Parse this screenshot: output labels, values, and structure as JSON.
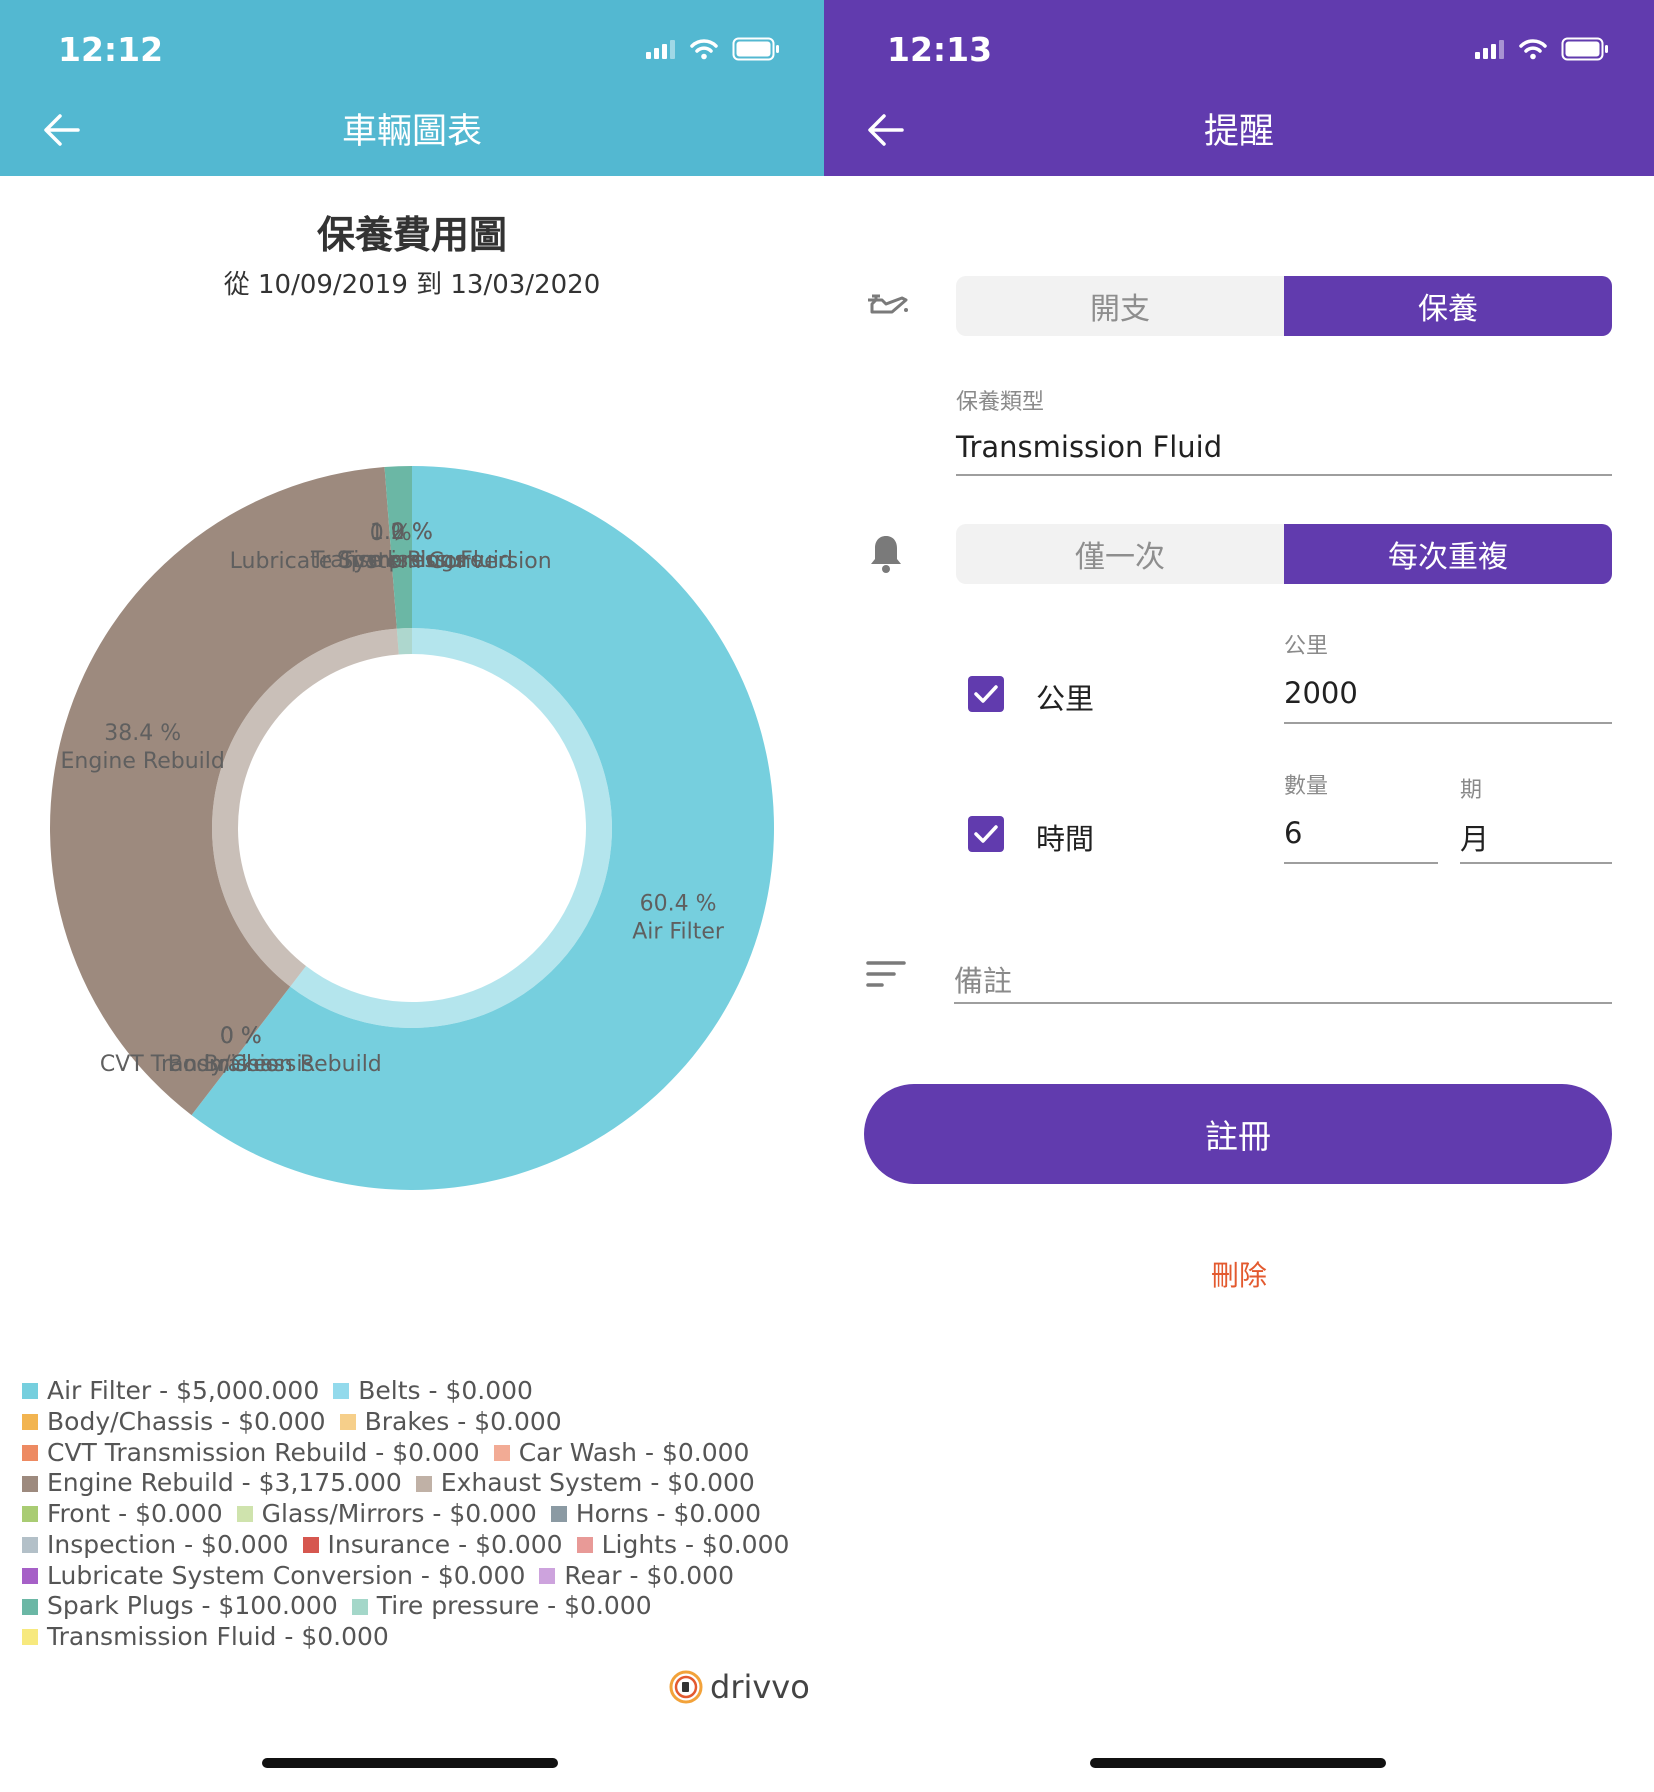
{
  "left": {
    "status_time": "12:12",
    "header_title": "車輛圖表",
    "chart_title": "保養費用圖",
    "chart_subtitle": "從 10/09/2019 到 13/03/2020",
    "brand": "drivvo",
    "accent_color": "#53b8d1"
  },
  "chart_data": {
    "type": "pie",
    "categories": [
      "Air Filter",
      "Belts",
      "Body/Chassis",
      "Brakes",
      "CVT Transmission Rebuild",
      "Car Wash",
      "Engine Rebuild",
      "Exhaust System",
      "Front",
      "Glass/Mirrors",
      "Horns",
      "Inspection",
      "Insurance",
      "Lights",
      "Lubricate System Conversion",
      "Rear",
      "Spark Plugs",
      "Tire pressure",
      "Transmission Fluid"
    ],
    "values": [
      5000,
      0,
      0,
      0,
      0,
      0,
      3175,
      0,
      0,
      0,
      0,
      0,
      0,
      0,
      0,
      0,
      100,
      0,
      0
    ],
    "colors": [
      "#76cfde",
      "#93daec",
      "#f2b450",
      "#f6cf8a",
      "#ed8a62",
      "#f2ab95",
      "#9d8a7e",
      "#c0b1a6",
      "#a9cc73",
      "#cfe3ad",
      "#8b9aa3",
      "#b3c0c8",
      "#d6574f",
      "#e89a97",
      "#a660c7",
      "#cda3dd",
      "#6bb7a5",
      "#a4d7c9",
      "#f7e97e"
    ],
    "slice_labels": [
      {
        "percent": "60.4 %",
        "name": "Air Filter"
      },
      {
        "percent": "38.4 %",
        "name": "Engine Rebuild"
      },
      {
        "percent": "0 %",
        "name": "CVT Transmission Rebuild"
      },
      {
        "percent": "0 %",
        "name": "Body/Chassis"
      },
      {
        "percent": "0 %",
        "name": "Brakes"
      },
      {
        "percent": "1.2 %",
        "name": "Spark Plugs"
      },
      {
        "percent": "0 %",
        "name": "Lubricate System Conversion"
      },
      {
        "percent": "0 %",
        "name": "Transmission Fluid"
      },
      {
        "percent": "0 %",
        "name": "Tire pressure"
      }
    ],
    "legend": [
      {
        "text": "Air Filter - $5,000.000",
        "color": "#76cfde"
      },
      {
        "text": "Belts - $0.000",
        "color": "#93daec"
      },
      {
        "text": "Body/Chassis - $0.000",
        "color": "#f2b450"
      },
      {
        "text": "Brakes - $0.000",
        "color": "#f6cf8a"
      },
      {
        "text": "CVT Transmission Rebuild - $0.000",
        "color": "#ed8a62"
      },
      {
        "text": "Car Wash - $0.000",
        "color": "#f2ab95"
      },
      {
        "text": "Engine Rebuild - $3,175.000",
        "color": "#9d8a7e"
      },
      {
        "text": "Exhaust System - $0.000",
        "color": "#c0b1a6"
      },
      {
        "text": "Front - $0.000",
        "color": "#a9cc73"
      },
      {
        "text": "Glass/Mirrors - $0.000",
        "color": "#cfe3ad"
      },
      {
        "text": "Horns - $0.000",
        "color": "#8b9aa3"
      },
      {
        "text": "Inspection - $0.000",
        "color": "#b3c0c8"
      },
      {
        "text": "Insurance - $0.000",
        "color": "#d6574f"
      },
      {
        "text": "Lights - $0.000",
        "color": "#e89a97"
      },
      {
        "text": "Lubricate System Conversion - $0.000",
        "color": "#a660c7"
      },
      {
        "text": "Rear - $0.000",
        "color": "#cda3dd"
      },
      {
        "text": "Spark Plugs - $100.000",
        "color": "#6bb7a5"
      },
      {
        "text": "Tire pressure - $0.000",
        "color": "#a4d7c9"
      },
      {
        "text": "Transmission Fluid - $0.000",
        "color": "#f7e97e"
      }
    ],
    "legend_rows": [
      [
        0,
        1
      ],
      [
        2,
        3
      ],
      [
        4,
        5
      ],
      [
        6,
        7
      ],
      [
        8,
        9,
        10
      ],
      [
        11,
        12,
        13
      ],
      [
        14,
        15
      ],
      [
        16,
        17
      ],
      [
        18
      ]
    ]
  },
  "right": {
    "status_time": "12:13",
    "header_title": "提醒",
    "accent_color": "#613bae",
    "type_toggle": [
      "開支",
      "保養"
    ],
    "maintenance_type_label": "保養類型",
    "maintenance_type_value": "Transmission Fluid",
    "repeat_toggle": [
      "僅一次",
      "每次重複"
    ],
    "km_checkbox_label": "公里",
    "km_field_label": "公里",
    "km_value": "2000",
    "time_checkbox_label": "時間",
    "quantity_label": "數量",
    "quantity_value": "6",
    "period_label": "期",
    "period_value": "月",
    "notes_placeholder": "備註",
    "register_label": "註冊",
    "delete_label": "刪除",
    "delete_color": "#e35a2f"
  }
}
